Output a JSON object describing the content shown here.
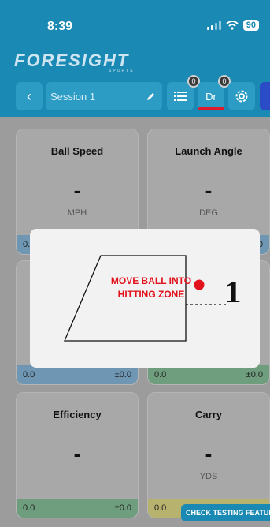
{
  "status_bar": {
    "time": "8:39",
    "battery": "90"
  },
  "brand": {
    "logo": "FORESIGHT",
    "sub": "SPORTS"
  },
  "toolbar": {
    "back_icon": "chevron-left-icon",
    "session_name": "Session 1",
    "edit_icon": "pencil-icon",
    "list_icon": "list-icon",
    "list_badge": "0",
    "club_label": "Dr",
    "club_badge": "0",
    "settings_icon": "gear-icon"
  },
  "cards": [
    {
      "title": "Ball Speed",
      "value": "-",
      "unit": "MPH",
      "left": "0.0",
      "right": ""
    },
    {
      "title": "Launch Angle",
      "value": "-",
      "unit": "DEG",
      "left": "",
      "right": "0"
    },
    {
      "title": "",
      "value": "",
      "unit": "",
      "left": "0.0",
      "right": "±0.0"
    },
    {
      "title": "",
      "value": "",
      "unit": "",
      "left": "0.0",
      "right": "±0.0"
    },
    {
      "title": "Efficiency",
      "value": "-",
      "unit": "",
      "left": "0.0",
      "right": "±0.0"
    },
    {
      "title": "Carry",
      "value": "-",
      "unit": "YDS",
      "left": "0.0",
      "right": ""
    }
  ],
  "modal": {
    "message": "MOVE BALL INTO HITTING ZONE",
    "marker": "1"
  },
  "testing_button": "CHECK TESTING FEATURES",
  "colors": {
    "header": "#1a8ab4",
    "accent_red": "#e1121c",
    "foot_blue": "#6f97b3",
    "foot_green": "#6e9e7e",
    "foot_yellow": "#b7b26e"
  }
}
